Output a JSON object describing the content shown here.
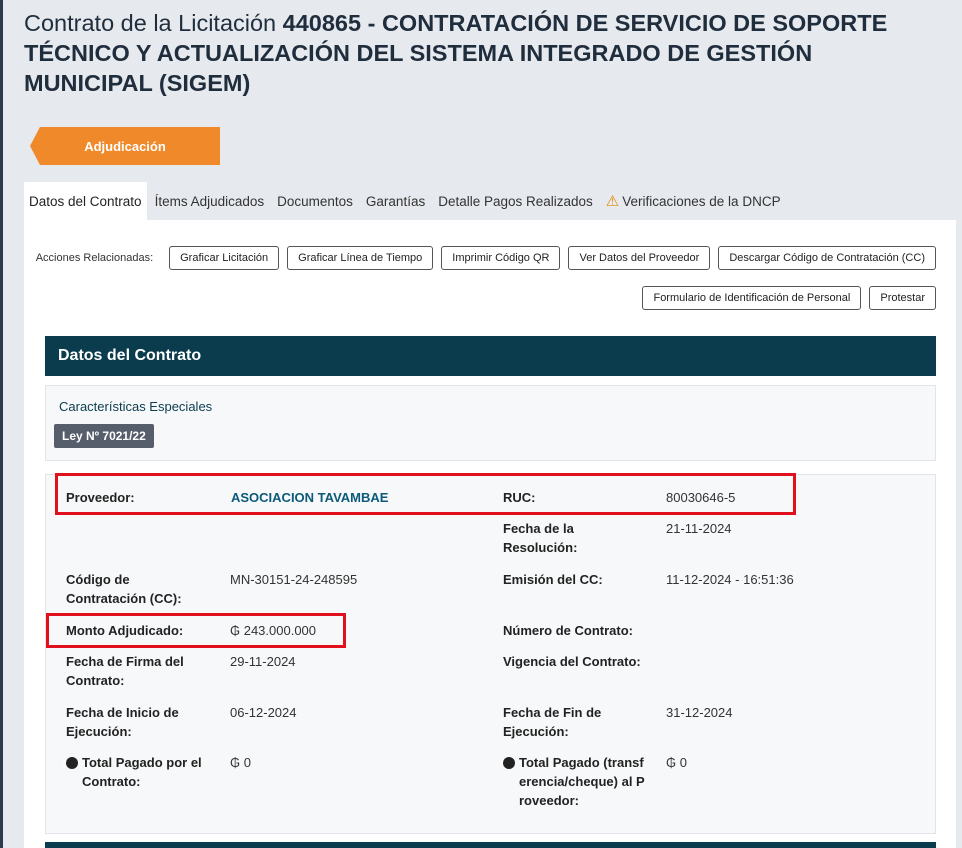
{
  "page": {
    "title_prefix": "Contrato de la Licitación",
    "title_rest": "440865 - CONTRATACIÓN DE SERVICIO DE SOPORTE TÉCNICO Y ACTUALIZACIÓN DEL SISTEMA INTEGRADO DE GESTIÓN MUNICIPAL (SIGEM)"
  },
  "stage": {
    "label": "Adjudicación",
    "color": "#f0892a"
  },
  "tabs": [
    {
      "label": "Datos del Contrato",
      "active": true
    },
    {
      "label": "Ítems Adjudicados"
    },
    {
      "label": "Documentos"
    },
    {
      "label": "Garantías"
    },
    {
      "label": "Detalle Pagos Realizados"
    },
    {
      "label": "Verificaciones de la DNCP",
      "icon": "warning-icon"
    }
  ],
  "actions": {
    "label": "Acciones Relacionadas:",
    "buttons": [
      "Graficar Licitación",
      "Graficar Línea de Tiempo",
      "Imprimir Código QR",
      "Ver Datos del Proveedor",
      "Descargar Código de Contratación (CC)",
      "Formulario de Identificación de Personal",
      "Protestar"
    ]
  },
  "section": {
    "title": "Datos del Contrato",
    "special_title": "Características Especiales",
    "law_badge": "Ley Nº 7021/22"
  },
  "details": {
    "proveedor_label": "Proveedor:",
    "proveedor_value": "ASOCIACION TAVAMBAE",
    "ruc_label": "RUC:",
    "ruc_value": "80030646-5",
    "fecha_resolucion_label": "Fecha de la Resolución:",
    "fecha_resolucion_value": "21-11-2024",
    "codigo_label": "Código de Contratación (CC):",
    "codigo_value": "MN-30151-24-248595",
    "emision_label": "Emisión del CC:",
    "emision_value": "11-12-2024 - 16:51:36",
    "monto_label": "Monto Adjudicado:",
    "monto_value": "₲ 243.000.000",
    "numero_label": "Número de Contrato:",
    "firma_label": "Fecha de Firma del Contrato:",
    "firma_value": "29-11-2024",
    "vigencia_label": "Vigencia del Contrato:",
    "inicio_label": "Fecha de Inicio de Ejecución:",
    "inicio_value": "06-12-2024",
    "fin_label": "Fecha de Fin de Ejecución:",
    "fin_value": "31-12-2024",
    "total_contrato_label": "Total Pagado por el Contrato:",
    "total_contrato_value": "₲ 0",
    "total_proveedor_label": "Total Pagado (transferencia/cheque) al Proveedor:",
    "total_proveedor_value": "₲ 0"
  },
  "colors": {
    "header_bg": "#0b3c4d",
    "highlight": "#e0111d",
    "link": "#0b5a7a"
  }
}
